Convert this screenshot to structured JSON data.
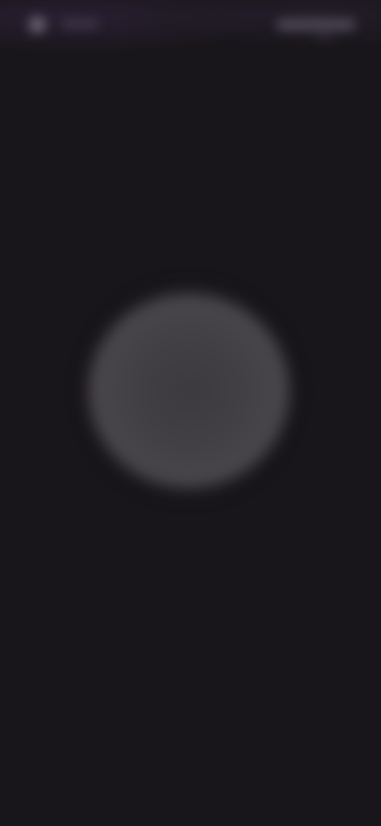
{
  "screen": {
    "state": "blurred-loading",
    "background_color": "#19161b",
    "accent_color": "#4b484d"
  },
  "status_bar": {
    "left_icon": "circle-indicator-icon",
    "right_icon": "status-cluster-icon"
  },
  "center": {
    "icon": "blurred-circle-icon"
  }
}
